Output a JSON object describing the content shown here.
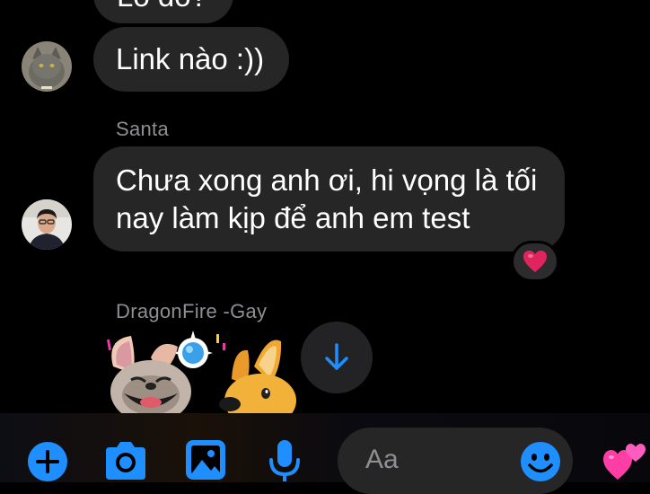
{
  "messages": [
    {
      "text": "Lò dó?"
    },
    {
      "text": "Link nào :))"
    },
    {
      "sender": "Santa",
      "line1": "Chưa xong anh ơi, hi vọng là tối",
      "line2": "nay làm kịp để anh em test",
      "reaction": "❤️"
    },
    {
      "sender": "DragonFire -Gay"
    }
  ],
  "compose": {
    "placeholder": "Aa"
  },
  "icons": {
    "add": "plus-icon",
    "camera": "camera-icon",
    "gallery": "image-icon",
    "voice": "microphone-icon",
    "emoji": "emoji-icon",
    "like": "hearts-icon",
    "scroll": "arrow-down-icon"
  },
  "colors": {
    "accent": "#1f8eff",
    "bubble": "#262626",
    "sender": "#8e8e93",
    "heart": "#e0245e",
    "like_pink": "#ff3ea5"
  }
}
